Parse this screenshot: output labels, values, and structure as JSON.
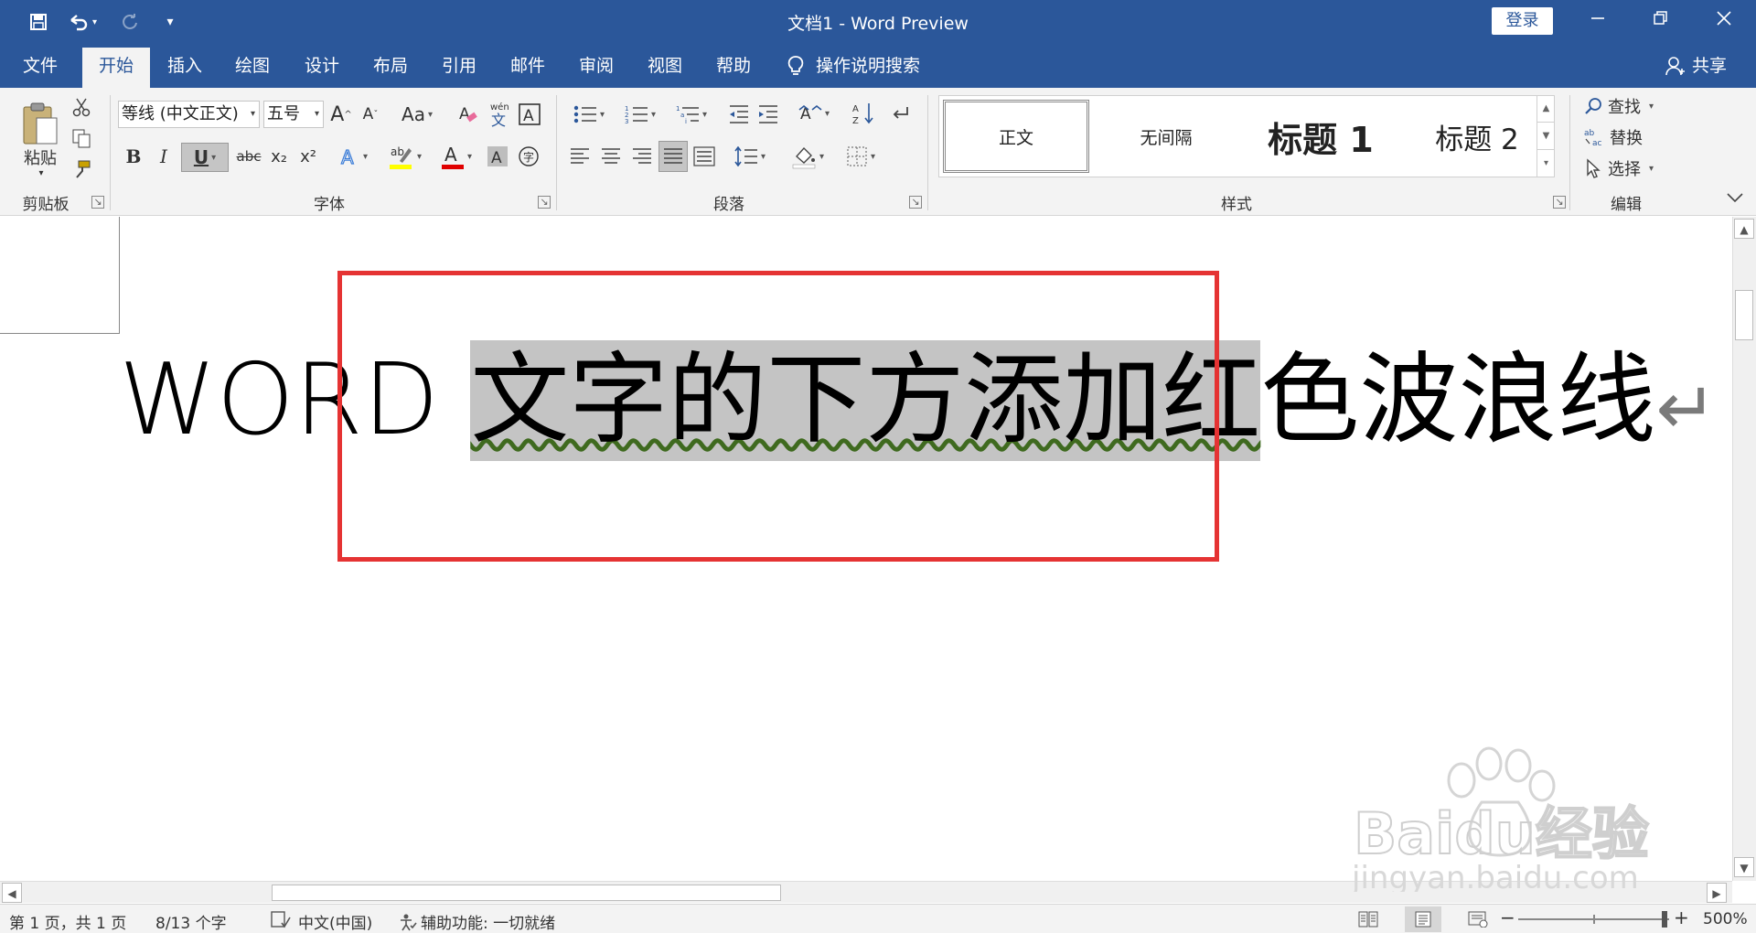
{
  "titlebar": {
    "title": "文档1  -  Word Preview",
    "login": "登录",
    "qa_more": "▾"
  },
  "tabs": [
    "文件",
    "开始",
    "插入",
    "绘图",
    "设计",
    "布局",
    "引用",
    "邮件",
    "审阅",
    "视图",
    "帮助"
  ],
  "active_tab": "开始",
  "search": {
    "label": "操作说明搜索"
  },
  "share": {
    "label": "共享"
  },
  "ribbon": {
    "clipboard": {
      "label": "剪贴板",
      "paste": "粘贴"
    },
    "font": {
      "label": "字体",
      "font_name": "等线 (中文正文)",
      "font_size": "五号",
      "bold": "B",
      "italic": "I",
      "underline": "U",
      "strike": "abc",
      "subscript": "x₂",
      "superscript": "x²",
      "case": "Aa",
      "grow": "A",
      "shrink": "A"
    },
    "paragraph": {
      "label": "段落"
    },
    "styles": {
      "label": "样式",
      "items": [
        "正文",
        "无间隔",
        "标题 1",
        "标题 2"
      ]
    },
    "editing": {
      "label": "编辑",
      "find": "查找",
      "replace": "替换",
      "select": "选择"
    }
  },
  "document": {
    "text_before": "WORD ",
    "text_selected": "文字的下方添加红",
    "text_after": "色波浪线",
    "underline_color": "#3f6a1f",
    "highlight_box_color": "#e53333"
  },
  "status": {
    "page": "第 1 页，共 1 页",
    "words": "8/13 个字",
    "language": "中文(中国)",
    "accessibility": "辅助功能: 一切就绪",
    "zoom": "500%",
    "zoom_minus": "−",
    "zoom_plus": "+"
  },
  "watermark": {
    "brand": "Baidu经验",
    "url": "jingyan.baidu.com"
  },
  "colors": {
    "brand": "#2b579a",
    "ribbon": "#f3f3f3"
  }
}
